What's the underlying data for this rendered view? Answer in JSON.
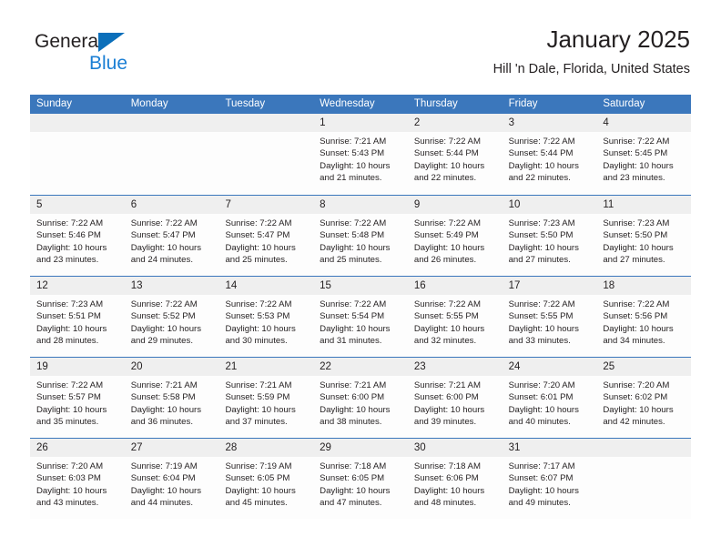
{
  "brand": {
    "name_part1": "General",
    "name_part2": "Blue",
    "triangle_color": "#0b6fba",
    "blue_color": "#1b7fd4"
  },
  "header": {
    "title": "January 2025",
    "location": "Hill 'n Dale, Florida, United States"
  },
  "theme": {
    "header_blue": "#3b77bc",
    "daynum_band": "#efefef",
    "cell_bg": "#fdfdfd",
    "text": "#231f20"
  },
  "weekdays": [
    "Sunday",
    "Monday",
    "Tuesday",
    "Wednesday",
    "Thursday",
    "Friday",
    "Saturday"
  ],
  "labels": {
    "sunrise_prefix": "Sunrise:",
    "sunset_prefix": "Sunset:",
    "daylight_prefix": "Daylight:"
  },
  "weeks": [
    [
      {
        "day": "",
        "sunrise": "",
        "sunset": "",
        "daylight_l1": "",
        "daylight_l2": ""
      },
      {
        "day": "",
        "sunrise": "",
        "sunset": "",
        "daylight_l1": "",
        "daylight_l2": ""
      },
      {
        "day": "",
        "sunrise": "",
        "sunset": "",
        "daylight_l1": "",
        "daylight_l2": ""
      },
      {
        "day": "1",
        "sunrise": "Sunrise: 7:21 AM",
        "sunset": "Sunset: 5:43 PM",
        "daylight_l1": "Daylight: 10 hours",
        "daylight_l2": "and 21 minutes."
      },
      {
        "day": "2",
        "sunrise": "Sunrise: 7:22 AM",
        "sunset": "Sunset: 5:44 PM",
        "daylight_l1": "Daylight: 10 hours",
        "daylight_l2": "and 22 minutes."
      },
      {
        "day": "3",
        "sunrise": "Sunrise: 7:22 AM",
        "sunset": "Sunset: 5:44 PM",
        "daylight_l1": "Daylight: 10 hours",
        "daylight_l2": "and 22 minutes."
      },
      {
        "day": "4",
        "sunrise": "Sunrise: 7:22 AM",
        "sunset": "Sunset: 5:45 PM",
        "daylight_l1": "Daylight: 10 hours",
        "daylight_l2": "and 23 minutes."
      }
    ],
    [
      {
        "day": "5",
        "sunrise": "Sunrise: 7:22 AM",
        "sunset": "Sunset: 5:46 PM",
        "daylight_l1": "Daylight: 10 hours",
        "daylight_l2": "and 23 minutes."
      },
      {
        "day": "6",
        "sunrise": "Sunrise: 7:22 AM",
        "sunset": "Sunset: 5:47 PM",
        "daylight_l1": "Daylight: 10 hours",
        "daylight_l2": "and 24 minutes."
      },
      {
        "day": "7",
        "sunrise": "Sunrise: 7:22 AM",
        "sunset": "Sunset: 5:47 PM",
        "daylight_l1": "Daylight: 10 hours",
        "daylight_l2": "and 25 minutes."
      },
      {
        "day": "8",
        "sunrise": "Sunrise: 7:22 AM",
        "sunset": "Sunset: 5:48 PM",
        "daylight_l1": "Daylight: 10 hours",
        "daylight_l2": "and 25 minutes."
      },
      {
        "day": "9",
        "sunrise": "Sunrise: 7:22 AM",
        "sunset": "Sunset: 5:49 PM",
        "daylight_l1": "Daylight: 10 hours",
        "daylight_l2": "and 26 minutes."
      },
      {
        "day": "10",
        "sunrise": "Sunrise: 7:23 AM",
        "sunset": "Sunset: 5:50 PM",
        "daylight_l1": "Daylight: 10 hours",
        "daylight_l2": "and 27 minutes."
      },
      {
        "day": "11",
        "sunrise": "Sunrise: 7:23 AM",
        "sunset": "Sunset: 5:50 PM",
        "daylight_l1": "Daylight: 10 hours",
        "daylight_l2": "and 27 minutes."
      }
    ],
    [
      {
        "day": "12",
        "sunrise": "Sunrise: 7:23 AM",
        "sunset": "Sunset: 5:51 PM",
        "daylight_l1": "Daylight: 10 hours",
        "daylight_l2": "and 28 minutes."
      },
      {
        "day": "13",
        "sunrise": "Sunrise: 7:22 AM",
        "sunset": "Sunset: 5:52 PM",
        "daylight_l1": "Daylight: 10 hours",
        "daylight_l2": "and 29 minutes."
      },
      {
        "day": "14",
        "sunrise": "Sunrise: 7:22 AM",
        "sunset": "Sunset: 5:53 PM",
        "daylight_l1": "Daylight: 10 hours",
        "daylight_l2": "and 30 minutes."
      },
      {
        "day": "15",
        "sunrise": "Sunrise: 7:22 AM",
        "sunset": "Sunset: 5:54 PM",
        "daylight_l1": "Daylight: 10 hours",
        "daylight_l2": "and 31 minutes."
      },
      {
        "day": "16",
        "sunrise": "Sunrise: 7:22 AM",
        "sunset": "Sunset: 5:55 PM",
        "daylight_l1": "Daylight: 10 hours",
        "daylight_l2": "and 32 minutes."
      },
      {
        "day": "17",
        "sunrise": "Sunrise: 7:22 AM",
        "sunset": "Sunset: 5:55 PM",
        "daylight_l1": "Daylight: 10 hours",
        "daylight_l2": "and 33 minutes."
      },
      {
        "day": "18",
        "sunrise": "Sunrise: 7:22 AM",
        "sunset": "Sunset: 5:56 PM",
        "daylight_l1": "Daylight: 10 hours",
        "daylight_l2": "and 34 minutes."
      }
    ],
    [
      {
        "day": "19",
        "sunrise": "Sunrise: 7:22 AM",
        "sunset": "Sunset: 5:57 PM",
        "daylight_l1": "Daylight: 10 hours",
        "daylight_l2": "and 35 minutes."
      },
      {
        "day": "20",
        "sunrise": "Sunrise: 7:21 AM",
        "sunset": "Sunset: 5:58 PM",
        "daylight_l1": "Daylight: 10 hours",
        "daylight_l2": "and 36 minutes."
      },
      {
        "day": "21",
        "sunrise": "Sunrise: 7:21 AM",
        "sunset": "Sunset: 5:59 PM",
        "daylight_l1": "Daylight: 10 hours",
        "daylight_l2": "and 37 minutes."
      },
      {
        "day": "22",
        "sunrise": "Sunrise: 7:21 AM",
        "sunset": "Sunset: 6:00 PM",
        "daylight_l1": "Daylight: 10 hours",
        "daylight_l2": "and 38 minutes."
      },
      {
        "day": "23",
        "sunrise": "Sunrise: 7:21 AM",
        "sunset": "Sunset: 6:00 PM",
        "daylight_l1": "Daylight: 10 hours",
        "daylight_l2": "and 39 minutes."
      },
      {
        "day": "24",
        "sunrise": "Sunrise: 7:20 AM",
        "sunset": "Sunset: 6:01 PM",
        "daylight_l1": "Daylight: 10 hours",
        "daylight_l2": "and 40 minutes."
      },
      {
        "day": "25",
        "sunrise": "Sunrise: 7:20 AM",
        "sunset": "Sunset: 6:02 PM",
        "daylight_l1": "Daylight: 10 hours",
        "daylight_l2": "and 42 minutes."
      }
    ],
    [
      {
        "day": "26",
        "sunrise": "Sunrise: 7:20 AM",
        "sunset": "Sunset: 6:03 PM",
        "daylight_l1": "Daylight: 10 hours",
        "daylight_l2": "and 43 minutes."
      },
      {
        "day": "27",
        "sunrise": "Sunrise: 7:19 AM",
        "sunset": "Sunset: 6:04 PM",
        "daylight_l1": "Daylight: 10 hours",
        "daylight_l2": "and 44 minutes."
      },
      {
        "day": "28",
        "sunrise": "Sunrise: 7:19 AM",
        "sunset": "Sunset: 6:05 PM",
        "daylight_l1": "Daylight: 10 hours",
        "daylight_l2": "and 45 minutes."
      },
      {
        "day": "29",
        "sunrise": "Sunrise: 7:18 AM",
        "sunset": "Sunset: 6:05 PM",
        "daylight_l1": "Daylight: 10 hours",
        "daylight_l2": "and 47 minutes."
      },
      {
        "day": "30",
        "sunrise": "Sunrise: 7:18 AM",
        "sunset": "Sunset: 6:06 PM",
        "daylight_l1": "Daylight: 10 hours",
        "daylight_l2": "and 48 minutes."
      },
      {
        "day": "31",
        "sunrise": "Sunrise: 7:17 AM",
        "sunset": "Sunset: 6:07 PM",
        "daylight_l1": "Daylight: 10 hours",
        "daylight_l2": "and 49 minutes."
      },
      {
        "day": "",
        "sunrise": "",
        "sunset": "",
        "daylight_l1": "",
        "daylight_l2": ""
      }
    ]
  ]
}
